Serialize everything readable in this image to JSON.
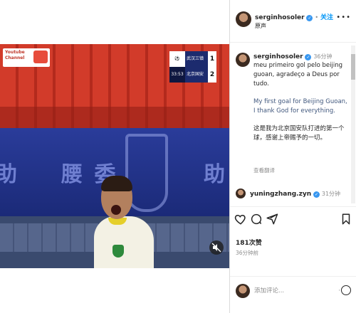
{
  "video": {
    "badge_line1": "Youtube",
    "badge_line2": "Channel",
    "board_text_left": "助",
    "board_text_mid": "腰 委",
    "board_text_right": "助",
    "scoreboard": {
      "team1": "武汉三镇",
      "team1_score": "1",
      "team2": "北京国安",
      "team2_score": "2",
      "clock": "33:53"
    }
  },
  "header": {
    "username": "serginhosoler",
    "separator": "•",
    "follow_label": "关注",
    "audio_label": "原声",
    "more_icon": "more-dots-icon"
  },
  "caption": {
    "username": "serginhosoler",
    "time": "36分钟",
    "text_pt": "meu primeiro gol pelo beijing guoan, agradeço a Deus por tudo.",
    "text_en": "My first goal for Beijing Guoan, I thank God for everything.",
    "text_zh": "这是我为北京国安队打进的第一个球，感谢上帝赐予的一切。",
    "translate_label": "查看翻译"
  },
  "comment1": {
    "username": "yuningzhang.zyn",
    "time": "31分钟"
  },
  "actions": {
    "like_icon": "heart-icon",
    "comment_icon": "comment-icon",
    "share_icon": "share-icon",
    "save_icon": "bookmark-icon"
  },
  "likes_label": "181次赞",
  "posted_label": "36分钟前",
  "add_comment": {
    "placeholder": "添加评论...",
    "emoji_label": "⋅⋅"
  },
  "colors": {
    "accent": "#0095f6",
    "verified": "#3897f0",
    "board_blue": "#1c2a6b"
  }
}
